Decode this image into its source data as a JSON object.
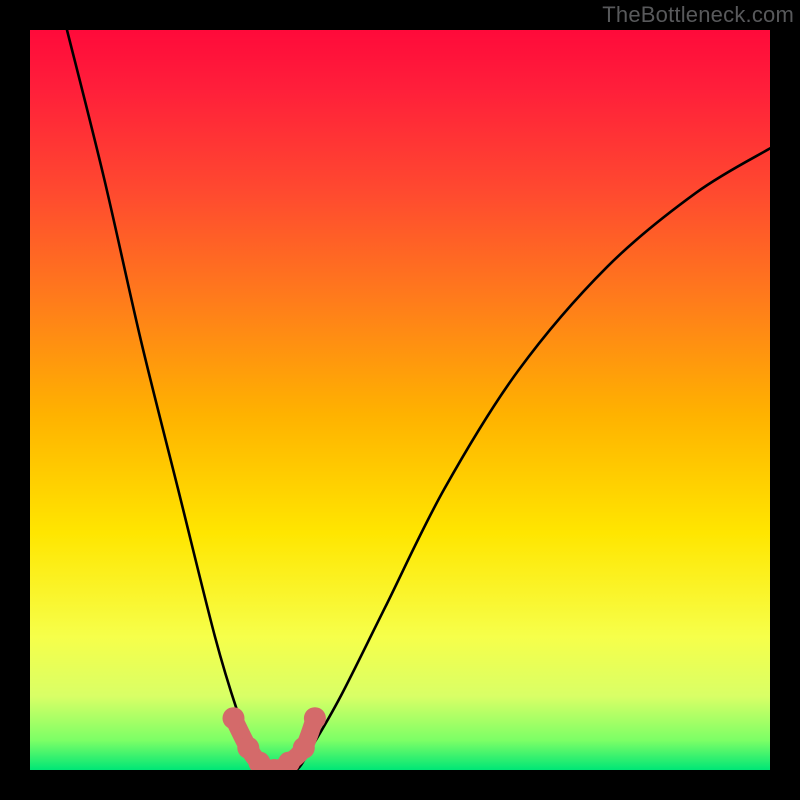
{
  "watermark": "TheBottleneck.com",
  "chart_data": {
    "type": "line",
    "title": "",
    "xlabel": "",
    "ylabel": "",
    "xlim": [
      0,
      100
    ],
    "ylim": [
      0,
      100
    ],
    "grid": false,
    "legend": false,
    "series": [
      {
        "name": "bottleneck-curve",
        "x": [
          5,
          10,
          15,
          20,
          25,
          28,
          30,
          32,
          34,
          36,
          38,
          42,
          48,
          56,
          66,
          78,
          90,
          100
        ],
        "y": [
          100,
          80,
          58,
          38,
          18,
          8,
          3,
          0,
          0,
          0,
          3,
          10,
          22,
          38,
          54,
          68,
          78,
          84
        ]
      }
    ],
    "annotations": [
      {
        "name": "highlight-bottom",
        "type": "points",
        "color": "#d46a6a",
        "x": [
          27.5,
          29.5,
          31,
          33,
          35,
          37,
          38.5
        ],
        "y": [
          7,
          3,
          1,
          0,
          1,
          3,
          7
        ]
      }
    ],
    "background_gradient": {
      "direction": "top-to-bottom",
      "stops": [
        {
          "pos": 0,
          "color": "#ff0a3a"
        },
        {
          "pos": 22,
          "color": "#ff4a2f"
        },
        {
          "pos": 52,
          "color": "#ffb200"
        },
        {
          "pos": 82,
          "color": "#f6ff4a"
        },
        {
          "pos": 100,
          "color": "#00e676"
        }
      ]
    }
  }
}
